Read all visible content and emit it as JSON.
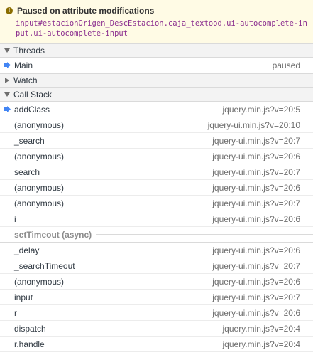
{
  "banner": {
    "title": "Paused on attribute modifications",
    "detail_prefix": "input",
    "detail_selector": "#estacionOrigen_DescEstacion.caja_textood.ui-autocomplete-input.ui-autocomplete-input"
  },
  "threads": {
    "header": "Threads",
    "items": [
      {
        "name": "Main",
        "status": "paused"
      }
    ]
  },
  "watch": {
    "header": "Watch"
  },
  "callstack": {
    "header": "Call Stack",
    "frames_before_async": [
      {
        "name": "addClass",
        "loc": "jquery.min.js?v=20:5"
      },
      {
        "name": "(anonymous)",
        "loc": "jquery-ui.min.js?v=20:10"
      },
      {
        "name": "_search",
        "loc": "jquery-ui.min.js?v=20:7"
      },
      {
        "name": "(anonymous)",
        "loc": "jquery-ui.min.js?v=20:6"
      },
      {
        "name": "search",
        "loc": "jquery-ui.min.js?v=20:7"
      },
      {
        "name": "(anonymous)",
        "loc": "jquery-ui.min.js?v=20:6"
      },
      {
        "name": "(anonymous)",
        "loc": "jquery-ui.min.js?v=20:7"
      },
      {
        "name": "i",
        "loc": "jquery-ui.min.js?v=20:6"
      }
    ],
    "async_label": "setTimeout (async)",
    "frames_after_async": [
      {
        "name": "_delay",
        "loc": "jquery-ui.min.js?v=20:6"
      },
      {
        "name": "_searchTimeout",
        "loc": "jquery-ui.min.js?v=20:7"
      },
      {
        "name": "(anonymous)",
        "loc": "jquery-ui.min.js?v=20:6"
      },
      {
        "name": "input",
        "loc": "jquery-ui.min.js?v=20:7"
      },
      {
        "name": "r",
        "loc": "jquery-ui.min.js?v=20:6"
      },
      {
        "name": "dispatch",
        "loc": "jquery.min.js?v=20:4"
      },
      {
        "name": "r.handle",
        "loc": "jquery.min.js?v=20:4"
      }
    ]
  },
  "colors": {
    "marker": "#4285f4",
    "banner_bg": "#fffbe5"
  }
}
